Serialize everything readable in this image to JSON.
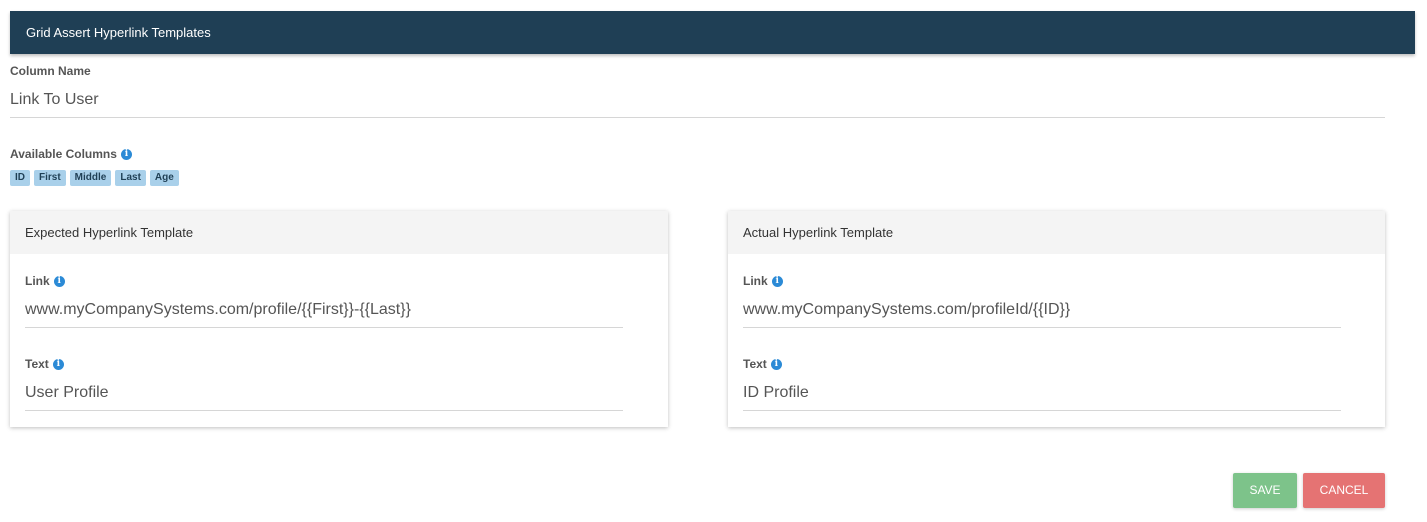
{
  "header": {
    "title": "Grid Assert Hyperlink Templates"
  },
  "column_name": {
    "label": "Column Name",
    "value": "Link To User"
  },
  "available_columns": {
    "label": "Available Columns",
    "chips": [
      "ID",
      "First",
      "Middle",
      "Last",
      "Age"
    ]
  },
  "expected": {
    "title": "Expected Hyperlink Template",
    "link_label": "Link",
    "link_value": "www.myCompanySystems.com/profile/{{First}}-{{Last}}",
    "text_label": "Text",
    "text_value": "User Profile"
  },
  "actual": {
    "title": "Actual Hyperlink Template",
    "link_label": "Link",
    "link_value": "www.myCompanySystems.com/profileId/{{ID}}",
    "text_label": "Text",
    "text_value": "ID Profile"
  },
  "buttons": {
    "save": "SAVE",
    "cancel": "CANCEL"
  },
  "icons": {
    "info": "info-icon"
  },
  "colors": {
    "header_bg": "#1f3f55",
    "chip_bg": "#a9d0ea",
    "save_bg": "#7dc38a",
    "cancel_bg": "#e57373",
    "info": "#2b8ad6"
  }
}
